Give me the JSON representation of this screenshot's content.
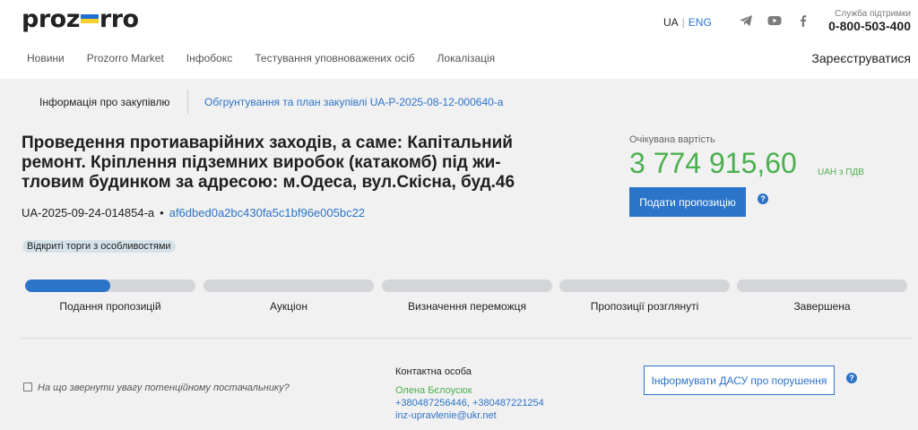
{
  "header": {
    "logo_left": "proz",
    "logo_right": "rro",
    "lang_ua": "UA",
    "lang_eng": "ENG",
    "support_label": "Служба підтримки",
    "support_phone": "0-800-503-400",
    "social_icons": [
      "telegram-icon",
      "youtube-icon",
      "facebook-icon"
    ]
  },
  "nav": {
    "items": [
      "Новини",
      "Prozorro Market",
      "Інфобокс",
      "Тестування уповноважених осіб",
      "Локалізація"
    ],
    "register": "Зареєструватися"
  },
  "tabs": {
    "info": "Інформація про закупівлю",
    "plan": "Обгрунтування та план закупівлі UA-P-2025-08-12-000640-a"
  },
  "tender": {
    "title": "Проведення протиаварійних заходів, а саме: Капітальний ремонт. Кріплення підземних виробок (катакомб) під жи-тловим будинком за адресою: м.Одеса, вул.Скісна, буд.46",
    "id": "UA-2025-09-24-014854-a",
    "hash": "af6dbed0a2bc430fa5c1bf96e005bc22",
    "procedure_badge": "Відкриті торги з особливостями"
  },
  "price": {
    "label": "Очікувана вартість",
    "value": "3 774 915,60",
    "currency_note": "UAH з ПДВ",
    "submit_label": "Подати пропозицію"
  },
  "steps": [
    {
      "label": "Подання пропозицій",
      "progress": 0.5
    },
    {
      "label": "Аукціон",
      "progress": 0
    },
    {
      "label": "Визначення переможця",
      "progress": 0
    },
    {
      "label": "Пропозиції розглянуті",
      "progress": 0
    },
    {
      "label": "Завершена",
      "progress": 0
    }
  ],
  "footer": {
    "attention": "На що звернути увагу потенційному постачальнику?",
    "contact_header": "Контактна особа",
    "contact_name": "Олена Бєлоусюк",
    "contact_phones": "+380487256446, +380487221254",
    "contact_email": "inz-upravlenie@ukr.net",
    "report_label": "Інформувати ДАСУ про порушення"
  },
  "colors": {
    "accent": "#2a74c9",
    "price_green": "#4caf50",
    "background_grey": "#f1f1f1"
  }
}
